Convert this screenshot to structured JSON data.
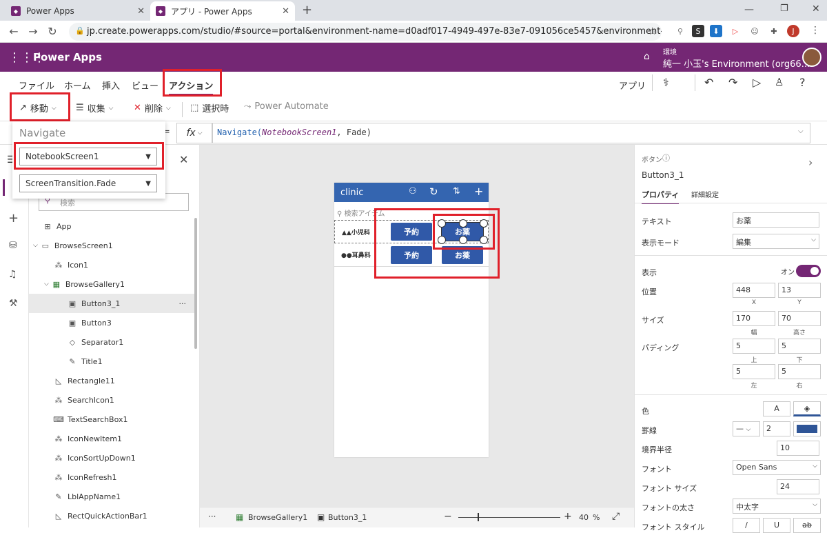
{
  "browser": {
    "tabs": [
      {
        "title": "Power Apps"
      },
      {
        "title": "アプリ - Power Apps"
      }
    ],
    "url": "jp.create.powerapps.com/studio/#source=portal&environment-name=d0adf017-4949-497e-83e7-091056ce5457&environment-update-cadence=..."
  },
  "header": {
    "brand": "Power Apps",
    "env_label": "環境",
    "env_name": "純一 小玉's Environment (org66...",
    "avatar_initial": "J"
  },
  "menu": {
    "items": [
      "ファイル",
      "ホーム",
      "挿入",
      "ビュー",
      "アクション"
    ],
    "right_label": "アプリ"
  },
  "commands": {
    "move": "移動",
    "collect": "収集",
    "delete": "削除",
    "onselect": "選択時",
    "automate": "Power Automate"
  },
  "formula": {
    "eq": "=",
    "fx": "fx",
    "fn": "Navigate(",
    "arg": "NotebookScreen1",
    "rest": ", Fade)"
  },
  "navigate_popup": {
    "title": "Navigate",
    "screen": "NotebookScreen1",
    "transition": "ScreenTransition.Fade"
  },
  "tree": {
    "search_placeholder": "検索",
    "nodes": [
      {
        "label": "App"
      },
      {
        "label": "BrowseScreen1"
      },
      {
        "label": "Icon1"
      },
      {
        "label": "BrowseGallery1"
      },
      {
        "label": "Button3_1"
      },
      {
        "label": "Button3"
      },
      {
        "label": "Separator1"
      },
      {
        "label": "Title1"
      },
      {
        "label": "Rectangle11"
      },
      {
        "label": "SearchIcon1"
      },
      {
        "label": "TextSearchBox1"
      },
      {
        "label": "IconNewItem1"
      },
      {
        "label": "IconSortUpDown1"
      },
      {
        "label": "IconRefresh1"
      },
      {
        "label": "LblAppName1"
      },
      {
        "label": "RectQuickActionBar1"
      }
    ],
    "more": "···"
  },
  "phone": {
    "title": "clinic",
    "search_placeholder": "検索アイテム",
    "rows": [
      {
        "name": "▲▲小児科",
        "btn1": "予約",
        "btn2": "お薬"
      },
      {
        "name": "●●耳鼻科",
        "btn1": "予約",
        "btn2": "お薬"
      }
    ]
  },
  "status": {
    "dots": "···",
    "crumb1": "BrowseGallery1",
    "crumb2": "Button3_1",
    "zoom_minus": "−",
    "zoom_plus": "+",
    "zoom_value": "40",
    "zoom_unit": "%"
  },
  "properties": {
    "type_label": "ボタン",
    "control_name": "Button3_1",
    "tab_props": "プロパティ",
    "tab_advanced": "詳細設定",
    "text_label": "テキスト",
    "text_value": "お薬",
    "display_mode_label": "表示モード",
    "display_mode_value": "編集",
    "visible_label": "表示",
    "visible_state": "オン",
    "position_label": "位置",
    "pos_x": "448",
    "pos_y": "13",
    "x_label": "X",
    "y_label": "Y",
    "size_label": "サイズ",
    "width_value": "170",
    "height_value": "70",
    "width_label": "幅",
    "height_label": "高さ",
    "padding_label": "パディング",
    "pad_top": "5",
    "pad_bottom": "5",
    "pad_left": "5",
    "pad_right": "5",
    "top_label": "上",
    "bottom_label": "下",
    "left_label": "左",
    "right_label": "右",
    "color_label": "色",
    "color_a": "A",
    "border_label": "罫線",
    "border_width": "2",
    "border_color": "#2f5597",
    "radius_label": "境界半径",
    "radius_value": "10",
    "font_label": "フォント",
    "font_value": "Open Sans",
    "font_size_label": "フォント サイズ",
    "font_size_value": "24",
    "font_weight_label": "フォントの太さ",
    "font_weight_value": "中太字",
    "font_style_label": "フォント スタイル",
    "font_style_i": "/",
    "font_style_u": "U",
    "font_style_s": "ab"
  },
  "colors": {
    "brand": "#742774",
    "highlight": "#e0202a",
    "phone_header": "#3465b0",
    "button": "#3059a8"
  }
}
